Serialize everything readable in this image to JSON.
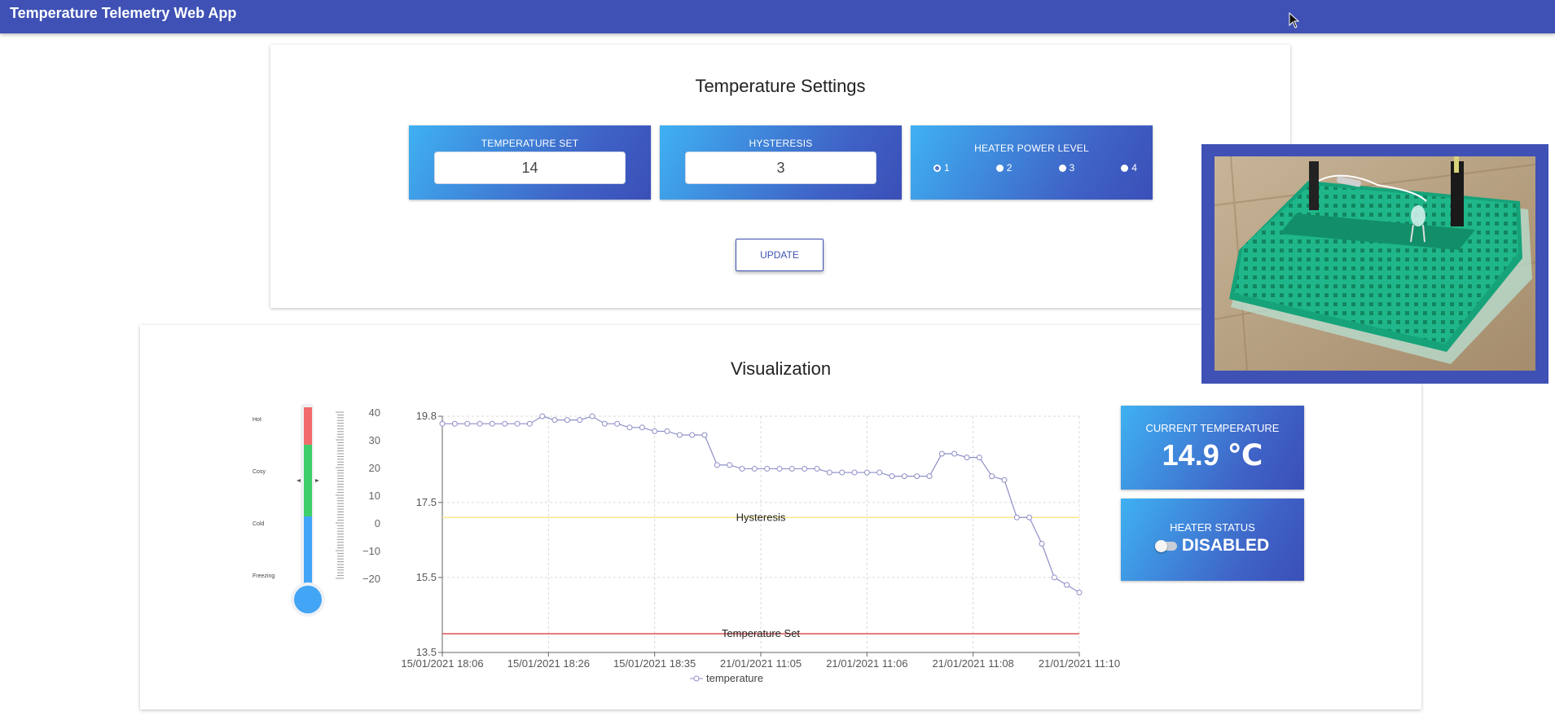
{
  "app": {
    "title": "Temperature Telemetry Web App"
  },
  "settings": {
    "title": "Temperature Settings",
    "temperature_set": {
      "label": "TEMPERATURE SET",
      "value": "14"
    },
    "hysteresis": {
      "label": "HYSTERESIS",
      "value": "3"
    },
    "heater_power": {
      "label": "HEATER POWER LEVEL",
      "options": [
        "1",
        "2",
        "3",
        "4"
      ],
      "selected": "1"
    },
    "update_label": "UPDATE"
  },
  "visualization": {
    "title": "Visualization",
    "thermometer": {
      "zones": [
        "Hot",
        "Cosy",
        "Cold",
        "Freezing"
      ],
      "scale": [
        "40",
        "30",
        "20",
        "10",
        "0",
        "−10",
        "−20"
      ],
      "colors": {
        "hot": "#f26b6b",
        "cosy": "#3ecf6a",
        "cold": "#42a5f5"
      }
    },
    "current_temperature": {
      "label": "CURRENT TEMPERATURE",
      "value": "14.9 ℃"
    },
    "heater_status": {
      "label": "HEATER STATUS",
      "value": "DISABLED"
    }
  },
  "chart_data": {
    "type": "line",
    "x_ticks": [
      "15/01/2021 18:06",
      "15/01/2021 18:26",
      "15/01/2021 18:35",
      "21/01/2021 11:05",
      "21/01/2021 11:06",
      "21/01/2021 11:08",
      "21/01/2021 11:10"
    ],
    "y_ticks": [
      "19.8",
      "17.5",
      "15.5",
      "13.5"
    ],
    "ylim": [
      13.5,
      19.8
    ],
    "series": [
      {
        "name": "temperature",
        "color": "#8e8ec8",
        "values": [
          19.6,
          19.6,
          19.6,
          19.6,
          19.6,
          19.6,
          19.6,
          19.6,
          19.8,
          19.7,
          19.7,
          19.7,
          19.8,
          19.6,
          19.6,
          19.5,
          19.5,
          19.4,
          19.4,
          19.3,
          19.3,
          19.3,
          18.5,
          18.5,
          18.4,
          18.4,
          18.4,
          18.4,
          18.4,
          18.4,
          18.4,
          18.3,
          18.3,
          18.3,
          18.3,
          18.3,
          18.2,
          18.2,
          18.2,
          18.2,
          18.8,
          18.8,
          18.7,
          18.7,
          18.2,
          18.1,
          17.1,
          17.1,
          16.4,
          15.5,
          15.3,
          15.1
        ]
      }
    ],
    "reference_lines": [
      {
        "label": "Hysteresis",
        "value": 17.1,
        "color": "#f5e88a"
      },
      {
        "label": "Temperature Set",
        "value": 14.0,
        "color": "#e05050"
      }
    ],
    "legend": "temperature",
    "legend_position": "bottom",
    "grid": true
  }
}
